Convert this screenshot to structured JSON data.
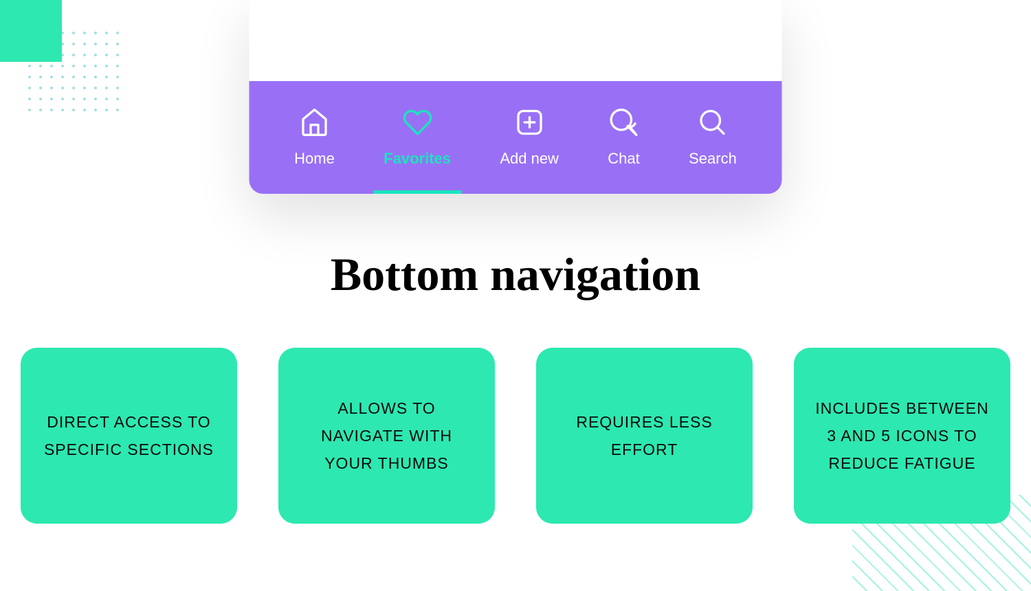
{
  "nav": {
    "items": [
      {
        "label": "Home",
        "icon": "home-icon",
        "active": false
      },
      {
        "label": "Favorites",
        "icon": "heart-icon",
        "active": true
      },
      {
        "label": "Add new",
        "icon": "plus-square-icon",
        "active": false
      },
      {
        "label": "Chat",
        "icon": "chat-icon",
        "active": false
      },
      {
        "label": "Search",
        "icon": "search-icon",
        "active": false
      }
    ]
  },
  "title": "Bottom navigation",
  "cards": [
    {
      "text": "DIRECT ACCESS TO SPECIFIC SECTIONS"
    },
    {
      "text": "ALLOWS TO NAVIGATE WITH YOUR THUMBS"
    },
    {
      "text": "REQUIRES LESS EFFORT"
    },
    {
      "text": "INCLUDES BETWEEN 3 AND 5 ICONS TO REDUCE FATIGUE"
    }
  ],
  "colors": {
    "accent": "#2de8b0",
    "purple": "#9970f5",
    "active": "#1ae5be"
  }
}
